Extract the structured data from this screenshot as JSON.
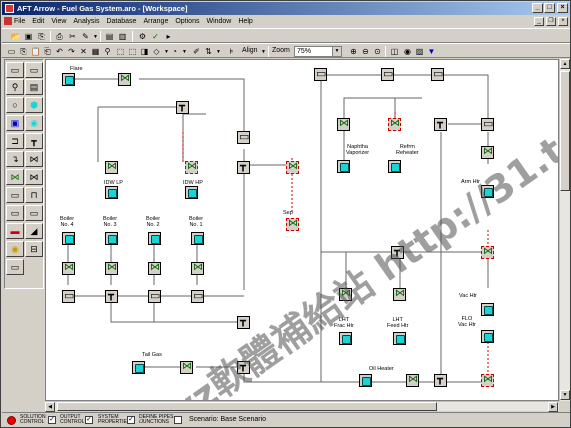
{
  "window": {
    "title": "AFT Arrow - Fuel Gas System.aro - [Workspace]"
  },
  "menu": [
    "File",
    "Edit",
    "View",
    "Analysis",
    "Database",
    "Arrange",
    "Options",
    "Window",
    "Help"
  ],
  "toolbar2": {
    "align_label": "Align",
    "zoom_label": "Zoom",
    "zoom_value": "75%"
  },
  "canvas": {
    "labels": {
      "flare": "Flare",
      "idw_lp": "IDW LP",
      "idw_hp": "IDW HP",
      "boiler4": "Boiler\nNo. 4",
      "boiler3": "Boiler\nNo. 3",
      "boiler2": "Boiler\nNo. 2",
      "boiler1": "Boiler\nNo. 1",
      "tail_gas": "Tail Gas",
      "sep": "Sep",
      "naphtha": "Naphtha\nVaporizer",
      "reformate": "Refrm\nReheater",
      "arm_htr": "Arm Htr",
      "vac_htr": "Vac Htr",
      "flo_vac_htr": "FLO\nVac Htr",
      "lht_frac": "LHT\nFrac Htr",
      "lht_feed": "LHT\nFeed Htr",
      "oil_heater": "Oil Heater"
    },
    "watermark": "xyz軟體補給站 http://31.to"
  },
  "status": {
    "solution_control": "SOLUTION\nCONTROL",
    "output_control": "OUTPUT\nCONTROL",
    "system_properties": "SYSTEM\nPROPERTIES",
    "define_pipes": "DEFINE PIPES\n/JUNCTIONS",
    "scenario": "Scenario: Base Scenario"
  },
  "colors": {
    "title_start": "#0a246a",
    "junction_fill": "#19d6d6",
    "valve_green": "#006000",
    "chrome": "#d4d0c8"
  }
}
